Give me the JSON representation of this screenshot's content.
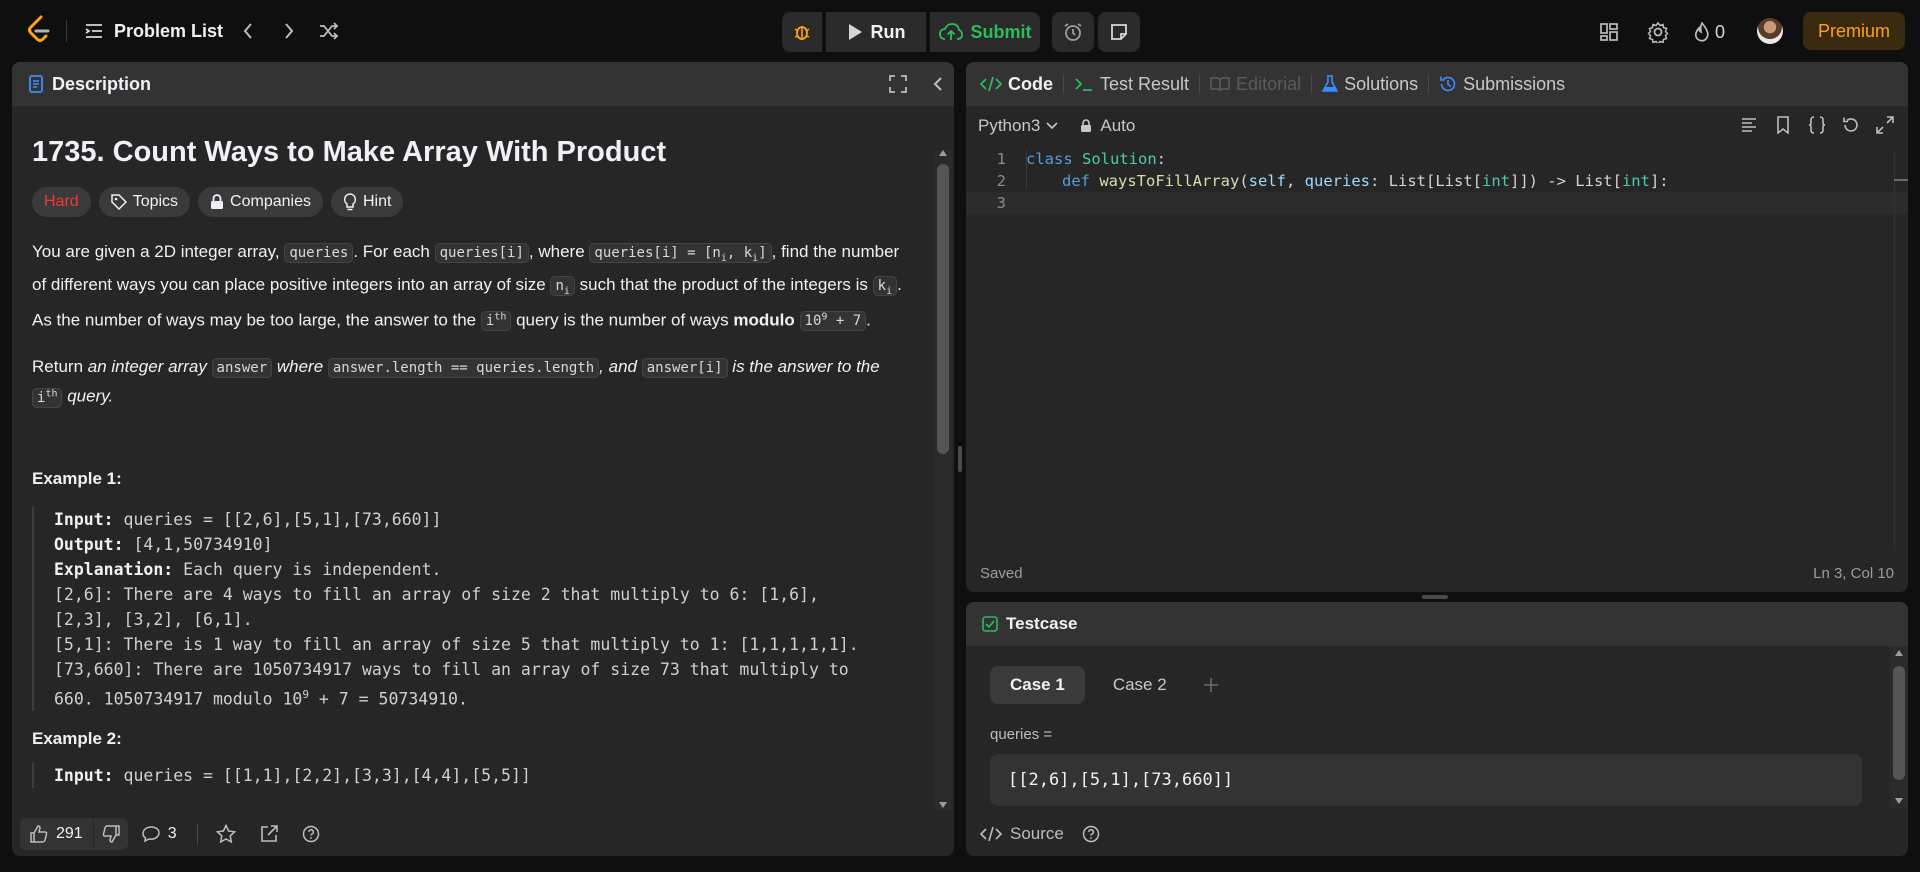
{
  "topbar": {
    "problem_list": "Problem List",
    "run": "Run",
    "submit": "Submit",
    "fire_count": "0",
    "premium": "Premium"
  },
  "description": {
    "tab_label": "Description",
    "title": "1735. Count Ways to Make Array With Product",
    "tags": [
      "Hard",
      "Topics",
      "Companies",
      "Hint"
    ],
    "para1_parts": [
      "You are given a 2D integer array, ",
      "queries",
      ". For each ",
      "queries[i]",
      ", where ",
      "queries[i] = [n",
      "i",
      ", k",
      "i",
      "]",
      ", find the number of different ways you can place positive integers into an array of size ",
      "n",
      "i",
      " such that the product of the integers is ",
      "k",
      "i",
      ". As the number of ways may be too large, the answer to the ",
      "i",
      "th",
      " query is the number of ways ",
      "modulo",
      " ",
      "10",
      "9",
      " + 7",
      "."
    ],
    "para2_parts": [
      "Return ",
      "an integer array ",
      "answer",
      " where ",
      "answer.length == queries.length",
      ", and ",
      "answer[i]",
      " is the answer to the ",
      "i",
      "th",
      " query."
    ],
    "example1_title": "Example 1:",
    "example1": {
      "input_label": "Input:",
      "input": " queries = [[2,6],[5,1],[73,660]]",
      "output_label": "Output:",
      "output": " [4,1,50734910]",
      "explanation_label": "Explanation:",
      "explanation": " Each query is independent.",
      "lines": [
        "[2,6]: There are 4 ways to fill an array of size 2 that multiply to 6: [1,6],",
        "[2,3], [3,2], [6,1].",
        "[5,1]: There is 1 way to fill an array of size 5 that multiply to 1: [1,1,1,1,1].",
        "[73,660]: There are 1050734917 ways to fill an array of size 73 that multiply to",
        "660. 1050734917 modulo 10",
        "9",
        " + 7 = 50734910."
      ]
    },
    "example2_title": "Example 2:",
    "example2_input": " queries = [[1,1],[2,2],[3,3],[4,4],[5,5]]",
    "likes": "291",
    "comments": "3"
  },
  "code": {
    "tabs": [
      "Code",
      "Test Result",
      "Editorial",
      "Solutions",
      "Submissions"
    ],
    "language": "Python3",
    "mode": "Auto",
    "line_numbers": [
      "1",
      "2",
      "3"
    ],
    "line1": [
      "class",
      " ",
      "Solution",
      ":"
    ],
    "line2": [
      "def",
      " ",
      "waysToFillArray",
      "(",
      "self",
      ", ",
      "queries",
      ": List[List[",
      "int",
      "]]) -> List[",
      "int",
      "]:"
    ],
    "status_left": "Saved",
    "status_right": "Ln 3, Col 10"
  },
  "testcase": {
    "title": "Testcase",
    "cases": [
      "Case 1",
      "Case 2"
    ],
    "queries_label": "queries =",
    "queries_value": "[[2,6],[5,1],[73,660]]",
    "source": "Source"
  }
}
